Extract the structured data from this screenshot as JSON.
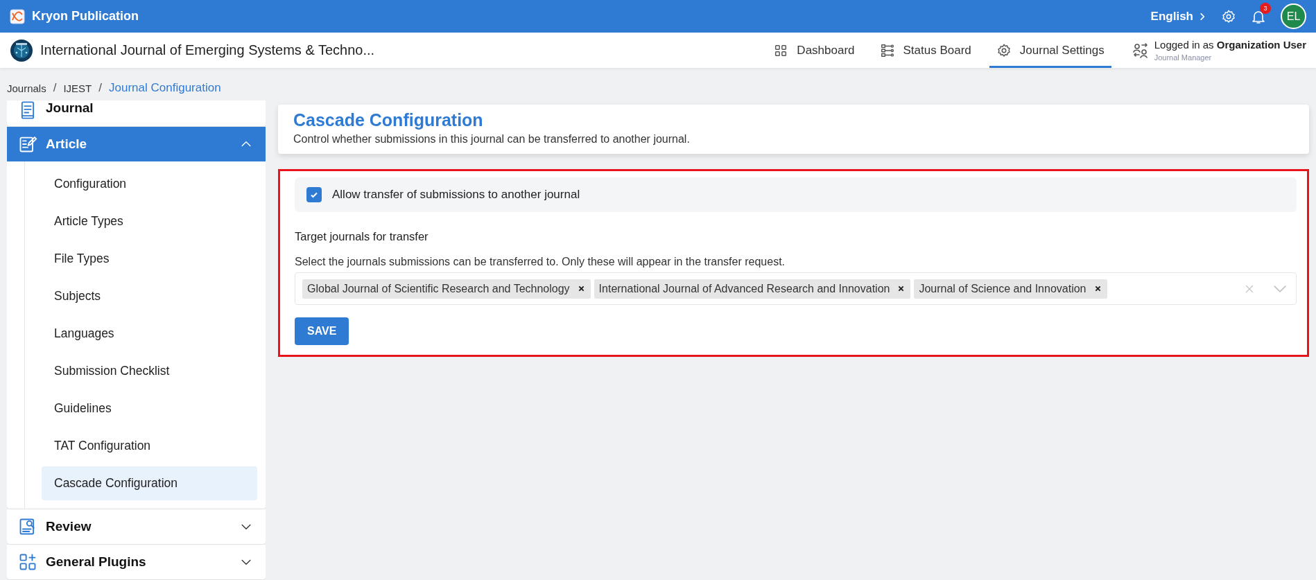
{
  "app": {
    "title": "Kryon Publication"
  },
  "top_bar": {
    "language": "English",
    "notifications": "3",
    "avatar": "EL"
  },
  "journal_bar": {
    "title": "International Journal of Emerging Systems & Techno...",
    "nav": [
      {
        "label": "Dashboard",
        "selected": false
      },
      {
        "label": "Status Board",
        "selected": false
      },
      {
        "label": "Journal Settings",
        "selected": true
      }
    ],
    "user": {
      "prefix": "Logged in as",
      "name": "Organization User",
      "role": "Journal Manager"
    }
  },
  "breadcrumb": [
    {
      "label": "Journals",
      "selected": false
    },
    {
      "separator": "/",
      "label": "IJEST",
      "selected": false
    },
    {
      "separator": "/",
      "label": "Journal Configuration",
      "selected": true
    }
  ],
  "sidebar": {
    "items": [
      {
        "label": "Journal",
        "kind": "link",
        "selected": false
      },
      {
        "label": "Article",
        "kind": "group",
        "selected": true,
        "expanded": true,
        "children": [
          {
            "label": "Configuration",
            "selected": false
          },
          {
            "label": "Article Types",
            "selected": false
          },
          {
            "label": "File Types",
            "selected": false
          },
          {
            "label": "Subjects",
            "selected": false
          },
          {
            "label": "Languages",
            "selected": false
          },
          {
            "label": "Submission Checklist",
            "selected": false
          },
          {
            "label": "Guidelines",
            "selected": false
          },
          {
            "label": "TAT Configuration",
            "selected": false
          },
          {
            "label": "Cascade Configuration",
            "selected": true
          }
        ]
      },
      {
        "label": "Review",
        "kind": "group",
        "selected": false,
        "expanded": false
      },
      {
        "label": "General Plugins",
        "kind": "group",
        "selected": false,
        "expanded": false
      }
    ]
  },
  "page_header": {
    "title": "Cascade Configuration",
    "description": "Control whether submissions in this journal can be transferred to another journal."
  },
  "form": {
    "allow_transfer": {
      "label": "Allow transfer of submissions to another journal",
      "checked": true
    },
    "targets": {
      "label": "Target journals for transfer",
      "help": "Select the journals submissions can be transferred to. Only these will appear in the transfer request.",
      "values": [
        "Global Journal of Scientific Research and Technology",
        "International Journal of Advanced Research and Innovation",
        "Journal of Science and Innovation"
      ]
    },
    "save": "SAVE"
  }
}
